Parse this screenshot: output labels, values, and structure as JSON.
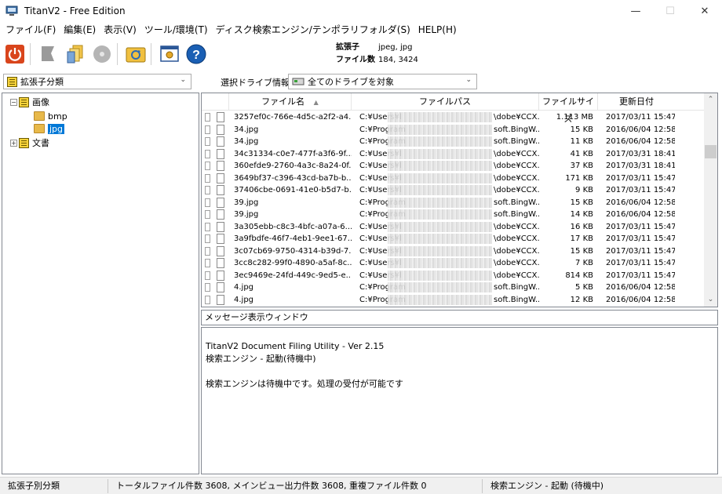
{
  "window": {
    "title": "TitanV2 - Free Edition",
    "minimize": "—",
    "maximize": "☐",
    "close": "✕"
  },
  "menu": [
    "ファイル(F)",
    "編集(E)",
    "表示(V)",
    "ツール/環境(T)",
    "ディスク検索エンジン/テンポラリフォルダ(S)",
    "HELP(H)"
  ],
  "toolbar": {
    "ext_label": "拡張子",
    "ext_value": "jpeg, jpg",
    "count_label": "ファイル数",
    "count_value": "184, 3424",
    "icons": [
      "power-icon",
      "bookmark-icon",
      "file-stack-icon",
      "disc-icon",
      "refresh-folder-icon",
      "settings-window-icon",
      "help-icon"
    ]
  },
  "classification": {
    "selected": "拡張子分類"
  },
  "drive": {
    "label": "選択ドライブ情報",
    "selected": "全てのドライブを対象"
  },
  "tree": {
    "nodes": [
      {
        "label": "画像",
        "expander": "−"
      },
      {
        "label": "bmp"
      },
      {
        "label": "jpg"
      },
      {
        "label": "文書",
        "expander": "+"
      }
    ]
  },
  "list": {
    "columns": [
      "ファイル名",
      "ファイルパス",
      "ファイルサイズ",
      "更新日付"
    ],
    "sort_indicator": "▲",
    "rows": [
      {
        "name": "3257ef0c-766e-4d5c-a2f2-a4...",
        "path_head": "C:¥Users¥l",
        "path_tail": "\\dobe¥CCX...",
        "size": "1.113 MB",
        "date": "2017/03/11 15:47"
      },
      {
        "name": "34.jpg",
        "path_head": "C:¥Program",
        "path_tail": "soft.BingW...",
        "size": "15 KB",
        "date": "2016/06/04 12:58"
      },
      {
        "name": "34.jpg",
        "path_head": "C:¥Program",
        "path_tail": "soft.BingW...",
        "size": "11 KB",
        "date": "2016/06/04 12:58"
      },
      {
        "name": "34c31334-c0e7-477f-a3f6-9f...",
        "path_head": "C:¥Users¥l",
        "path_tail": "\\dobe¥CCX...",
        "size": "41 KB",
        "date": "2017/03/31 18:41"
      },
      {
        "name": "360efde9-2760-4a3c-8a24-0f...",
        "path_head": "C:¥Users¥l",
        "path_tail": "\\dobe¥CCX...",
        "size": "37 KB",
        "date": "2017/03/31 18:41"
      },
      {
        "name": "3649bf37-c396-43cd-ba7b-b...",
        "path_head": "C:¥Users¥l",
        "path_tail": "\\dobe¥CCX...",
        "size": "171 KB",
        "date": "2017/03/11 15:47"
      },
      {
        "name": "37406cbe-0691-41e0-b5d7-b...",
        "path_head": "C:¥Users¥l",
        "path_tail": "\\dobe¥CCX...",
        "size": "9 KB",
        "date": "2017/03/11 15:47"
      },
      {
        "name": "39.jpg",
        "path_head": "C:¥Program",
        "path_tail": "soft.BingW...",
        "size": "15 KB",
        "date": "2016/06/04 12:58"
      },
      {
        "name": "39.jpg",
        "path_head": "C:¥Program",
        "path_tail": "soft.BingW...",
        "size": "14 KB",
        "date": "2016/06/04 12:58"
      },
      {
        "name": "3a305ebb-c8c3-4bfc-a07a-6...",
        "path_head": "C:¥Users¥l",
        "path_tail": "\\dobe¥CCX...",
        "size": "16 KB",
        "date": "2017/03/11 15:47"
      },
      {
        "name": "3a9fbdfe-46f7-4eb1-9ee1-67...",
        "path_head": "C:¥Users¥l",
        "path_tail": "\\dobe¥CCX...",
        "size": "17 KB",
        "date": "2017/03/11 15:47"
      },
      {
        "name": "3c07cb69-9750-4314-b39d-7...",
        "path_head": "C:¥Users¥l",
        "path_tail": "\\dobe¥CCX...",
        "size": "15 KB",
        "date": "2017/03/11 15:47"
      },
      {
        "name": "3cc8c282-99f0-4890-a5af-8c...",
        "path_head": "C:¥Users¥l",
        "path_tail": "\\dobe¥CCX...",
        "size": "7 KB",
        "date": "2017/03/11 15:47"
      },
      {
        "name": "3ec9469e-24fd-449c-9ed5-e...",
        "path_head": "C:¥Users¥l",
        "path_tail": "\\dobe¥CCX...",
        "size": "814 KB",
        "date": "2017/03/11 15:47"
      },
      {
        "name": "4.jpg",
        "path_head": "C:¥Program",
        "path_tail": "soft.BingW...",
        "size": "5 KB",
        "date": "2016/06/04 12:58"
      },
      {
        "name": "4.jpg",
        "path_head": "C:¥Program",
        "path_tail": "soft.BingW...",
        "size": "12 KB",
        "date": "2016/06/04 12:58"
      }
    ]
  },
  "message": {
    "title": "メッセージ表示ウィンドウ",
    "line1": "TitanV2 Document Filing Utility - Ver 2.15",
    "line2": "検索エンジン - 起動(待機中)",
    "line3": "検索エンジンは待機中です。処理の受付が可能です"
  },
  "status": {
    "mode": "拡張子別分類",
    "counts": "トータルファイル件数 3608, メインビュー出力件数 3608, 重複ファイル件数 0",
    "engine": "検索エンジン - 起動 (待機中)"
  },
  "colors": {
    "accent": "#0078d7",
    "power": "#d9451c",
    "help": "#1a5fb4"
  }
}
